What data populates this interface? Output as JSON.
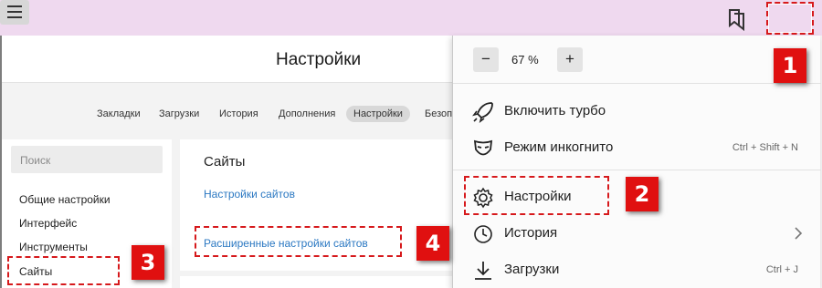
{
  "toolbar": {
    "bookmarks_icon": "bookmarks-icon",
    "menu_icon": "hamburger-menu-icon"
  },
  "settings": {
    "title": "Настройки",
    "tabs": [
      {
        "label": "Закладки"
      },
      {
        "label": "Загрузки"
      },
      {
        "label": "История"
      },
      {
        "label": "Дополнения"
      },
      {
        "label": "Настройки"
      },
      {
        "label": "Безопа"
      }
    ],
    "active_tab": "Настройки",
    "search_placeholder": "Поиск",
    "nav": [
      {
        "label": "Общие настройки"
      },
      {
        "label": "Интерфейс"
      },
      {
        "label": "Инструменты"
      },
      {
        "label": "Сайты"
      }
    ],
    "section": {
      "title": "Сайты",
      "links": [
        {
          "label": "Настройки сайтов"
        },
        {
          "label": "Расширенные настройки сайтов"
        }
      ]
    }
  },
  "menu": {
    "zoom": {
      "minus": "−",
      "value": "67 %",
      "plus": "+"
    },
    "items": [
      {
        "label": "Включить турбо",
        "shortcut": "",
        "icon": "rocket-icon"
      },
      {
        "label": "Режим инкогнито",
        "shortcut": "Ctrl + Shift + N",
        "icon": "mask-icon"
      },
      {
        "label": "Настройки",
        "shortcut": "",
        "icon": "gear-icon"
      },
      {
        "label": "История",
        "shortcut": "",
        "icon": "clock-icon"
      },
      {
        "label": "Загрузки",
        "shortcut": "Ctrl + J",
        "icon": "download-icon"
      }
    ]
  },
  "annotations": {
    "badges": [
      "1",
      "2",
      "3",
      "4"
    ],
    "color": "#e01010"
  }
}
